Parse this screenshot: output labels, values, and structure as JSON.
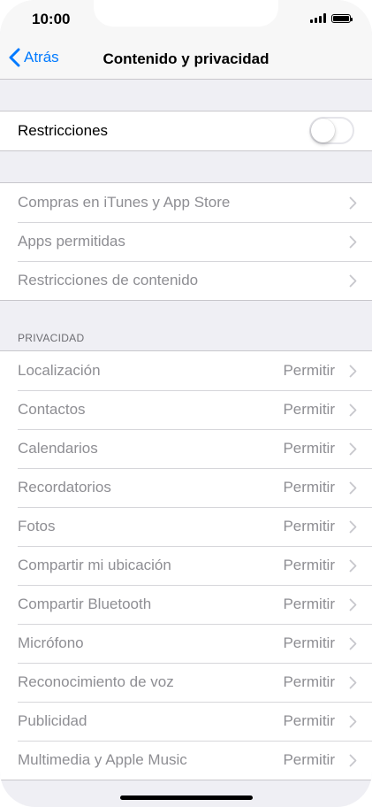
{
  "status_bar": {
    "time": "10:00"
  },
  "nav": {
    "back_label": "Atrás",
    "title": "Contenido y privacidad"
  },
  "restrictions": {
    "label": "Restricciones",
    "enabled": false
  },
  "store_group": [
    {
      "label": "Compras en iTunes y App Store"
    },
    {
      "label": "Apps permitidas"
    },
    {
      "label": "Restricciones de contenido"
    }
  ],
  "privacy": {
    "header": "PRIVACIDAD",
    "items": [
      {
        "label": "Localización",
        "value": "Permitir"
      },
      {
        "label": "Contactos",
        "value": "Permitir"
      },
      {
        "label": "Calendarios",
        "value": "Permitir"
      },
      {
        "label": "Recordatorios",
        "value": "Permitir"
      },
      {
        "label": "Fotos",
        "value": "Permitir"
      },
      {
        "label": "Compartir mi ubicación",
        "value": "Permitir"
      },
      {
        "label": "Compartir Bluetooth",
        "value": "Permitir"
      },
      {
        "label": "Micrófono",
        "value": "Permitir"
      },
      {
        "label": "Reconocimiento de voz",
        "value": "Permitir"
      },
      {
        "label": "Publicidad",
        "value": "Permitir"
      },
      {
        "label": "Multimedia y Apple Music",
        "value": "Permitir"
      }
    ]
  },
  "colors": {
    "accent": "#007aff",
    "disabled_text": "#8e8e93",
    "background": "#efeff4"
  }
}
